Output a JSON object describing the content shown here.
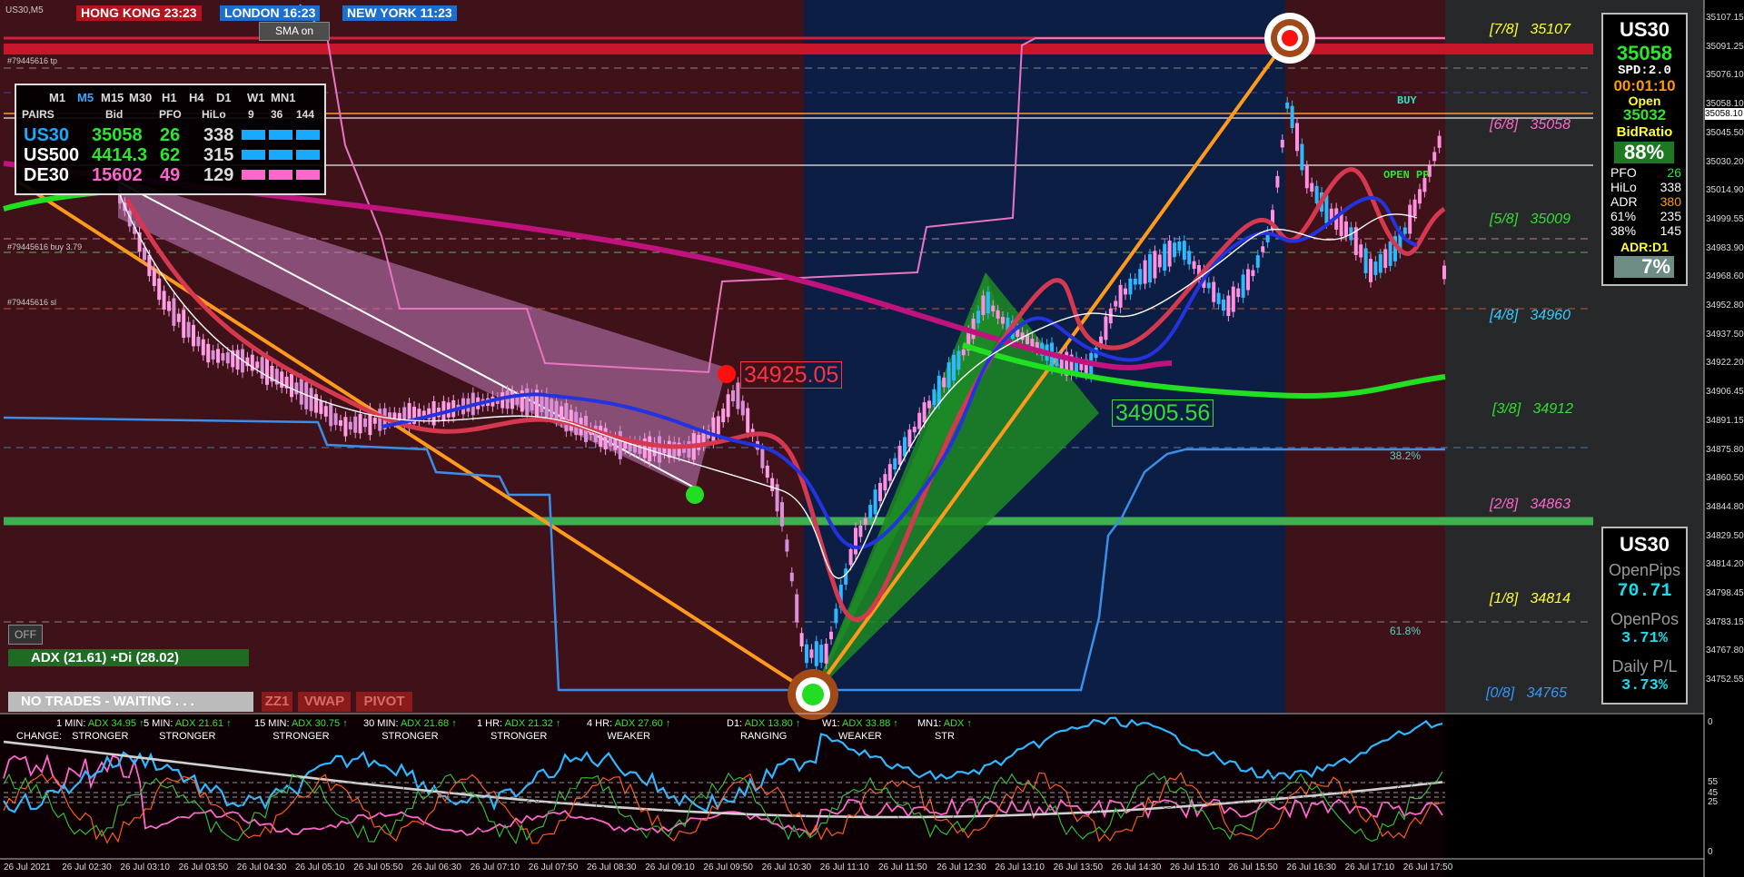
{
  "symbol_label": "US30,M5",
  "sessions": [
    {
      "label": "HONG KONG  23:23",
      "color": "#b3141e"
    },
    {
      "label": "LONDON   16:23",
      "color": "#1a6fd1"
    },
    {
      "label": "NEW YORK  11:23",
      "color": "#1a6fd1"
    }
  ],
  "sma_button": "SMA on",
  "pairs_table": {
    "timeframes": [
      "M1",
      "M5",
      "M15",
      "M30",
      "H1",
      "H4",
      "D1",
      "W1",
      "MN1"
    ],
    "active_timeframe": "M5",
    "columns": [
      "PAIRS",
      "Bid",
      "PFO",
      "HiLo",
      "9",
      "36",
      "144"
    ],
    "rows": [
      {
        "pair": "US30",
        "bid": "35058",
        "pfo": "26",
        "hilo": "338",
        "color": "#19aaff",
        "bid_color": "#2ee52e"
      },
      {
        "pair": "US500",
        "bid": "4414.3",
        "pfo": "62",
        "hilo": "315",
        "color": "#ffffff",
        "bid_color": "#2ee52e"
      },
      {
        "pair": "DE30",
        "bid": "15602",
        "pfo": "49",
        "hilo": "129",
        "color": "#ffffff",
        "bid_color": "#ff66cc"
      }
    ]
  },
  "order_labels": [
    "#79445616 tp",
    "#79445616 buy 3.79",
    "#79445616 sl"
  ],
  "price_callouts": {
    "high": "34925.05",
    "low": "34905.56"
  },
  "fib_levels": [
    {
      "label": "[7/8]",
      "value": "35107",
      "color": "#ffff33"
    },
    {
      "label": "[6/8]",
      "value": "35058",
      "color": "#ff66cc"
    },
    {
      "label": "[5/8]",
      "value": "35009",
      "color": "#33dd33"
    },
    {
      "label": "[4/8]",
      "value": "34960",
      "color": "#33ccff"
    },
    {
      "label": "[3/8]",
      "value": "34912",
      "color": "#33dd33"
    },
    {
      "label": "[2/8]",
      "value": "34863",
      "color": "#ff66cc"
    },
    {
      "label": "[1/8]",
      "value": "34814",
      "color": "#ffff33"
    },
    {
      "label": "[0/8]",
      "value": "34765",
      "color": "#3399ff"
    }
  ],
  "fib_retracements": [
    "38.2%",
    "61.8%"
  ],
  "chart_labels": {
    "buy": "BUY",
    "open": "OPEN  PP"
  },
  "price_axis": [
    "35107.15",
    "35091.25",
    "35076.10",
    "35058.10",
    "35045.50",
    "35030.20",
    "35014.90",
    "34999.55",
    "34983.90",
    "34968.60",
    "34952.80",
    "34937.50",
    "34922.20",
    "34906.45",
    "34891.15",
    "34875.80",
    "34860.50",
    "34844.80",
    "34829.50",
    "34814.20",
    "34798.45",
    "34783.15",
    "34767.80",
    "34752.55"
  ],
  "current_price": "35058.10",
  "indicator_axis": [
    "0",
    "55",
    "45",
    "25",
    "0"
  ],
  "time_axis": [
    "26 Jul 2021",
    "26 Jul 02:30",
    "26 Jul 03:10",
    "26 Jul 03:50",
    "26 Jul 04:30",
    "26 Jul 05:10",
    "26 Jul 05:50",
    "26 Jul 06:30",
    "26 Jul 07:10",
    "26 Jul 07:50",
    "26 Jul 08:30",
    "26 Jul 09:10",
    "26 Jul 09:50",
    "26 Jul 10:30",
    "26 Jul 11:10",
    "26 Jul 11:50",
    "26 Jul 12:30",
    "26 Jul 13:10",
    "26 Jul 13:50",
    "26 Jul 14:30",
    "26 Jul 15:10",
    "26 Jul 15:50",
    "26 Jul 16:30",
    "26 Jul 17:10",
    "26 Jul 17:50"
  ],
  "panel_top": {
    "symbol": "US30",
    "price": "35058",
    "spread": "SPD:2.0",
    "timer": "00:01:10",
    "open_label": "Open",
    "open_value": "35032",
    "bidratio_label": "BidRatio",
    "bidratio": "88%",
    "stats": [
      {
        "k": "PFO",
        "v": "26",
        "color": "#2ee52e"
      },
      {
        "k": "HiLo",
        "v": "338",
        "color": "#ffffff"
      },
      {
        "k": "ADR",
        "v": "380",
        "color": "#ff9900"
      },
      {
        "k": "61%",
        "v": "235",
        "color": "#ffffff"
      },
      {
        "k": "38%",
        "v": "145",
        "color": "#ffffff"
      }
    ],
    "adr_label": "ADR:D1",
    "adr_value": "7%"
  },
  "panel_bottom": {
    "symbol": "US30",
    "open_pips_label": "OpenPips",
    "open_pips": "70.71",
    "open_pos_label": "OpenPos",
    "open_pos": "3.71%",
    "daily_label": "Daily P/L",
    "daily": "3.73%"
  },
  "off_button": "OFF",
  "adx_status": "ADX (21.61)   +Di (28.02)",
  "no_trades": "NO TRADES - WAITING . . .",
  "bottom_buttons": [
    "ZZ1",
    "VWAP",
    "PIVOT"
  ],
  "adx_strip": [
    {
      "tf": "1 MIN:",
      "adx": "ADX 34.95",
      "state": "STRONGER"
    },
    {
      "tf": "5 MIN:",
      "adx": "ADX 21.61",
      "state": "STRONGER"
    },
    {
      "tf": "15 MIN:",
      "adx": "ADX 30.75",
      "state": "STRONGER"
    },
    {
      "tf": "30 MIN:",
      "adx": "ADX 21.68",
      "state": "STRONGER"
    },
    {
      "tf": "1 HR:",
      "adx": "ADX 21.32",
      "state": "STRONGER"
    },
    {
      "tf": "4 HR:",
      "adx": "ADX 27.60",
      "state": "WEAKER"
    },
    {
      "tf": "D1:",
      "adx": "ADX 13.80",
      "state": "RANGING"
    },
    {
      "tf": "W1:",
      "adx": "ADX 33.88",
      "state": "WEAKER"
    },
    {
      "tf": "MN1:",
      "adx": "ADX",
      "state": "STR"
    }
  ],
  "change_label": "CHANGE:"
}
